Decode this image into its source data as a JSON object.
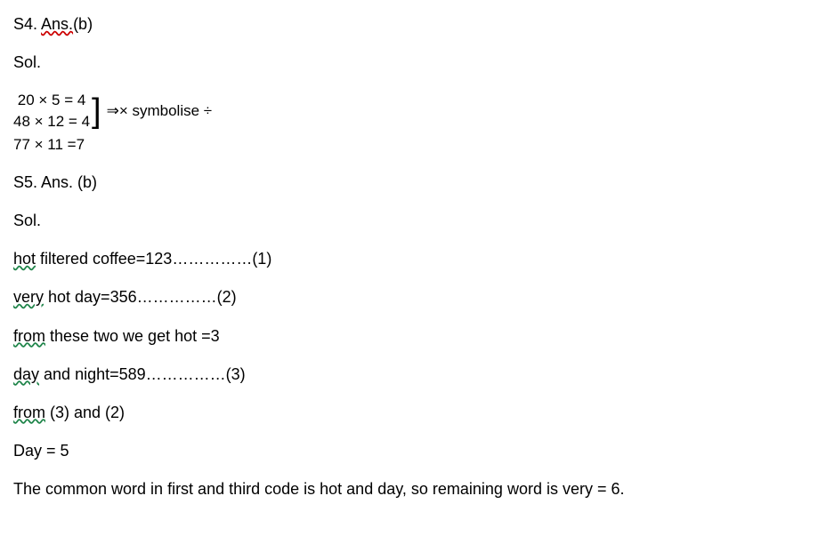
{
  "s4": {
    "header_prefix": "S4. ",
    "header_ans": "Ans.",
    "header_suffix": "(b)",
    "sol": "Sol.",
    "math_line1": "20 × 5 = 4",
    "math_line2": "48 × 12 = 4",
    "symbolise": " ⇒× symbolise ÷",
    "math_line3": "77 × 11 =7"
  },
  "s5": {
    "header": "S5. Ans. (b)",
    "sol": "Sol.",
    "line1_word": "hot",
    "line1_rest": " filtered coffee=123……………(1)",
    "line2_word": "very",
    "line2_rest": " hot day=356……………(2)",
    "line3_word": "from",
    "line3_rest": " these two we get hot =3",
    "line4_word": "day",
    "line4_rest": " and night=589……………(3)",
    "line5_word": "from",
    "line5_rest": " (3) and (2)",
    "line6": "Day = 5",
    "line7": "The common word in first and third code is hot and day, so remaining word is very = 6."
  }
}
